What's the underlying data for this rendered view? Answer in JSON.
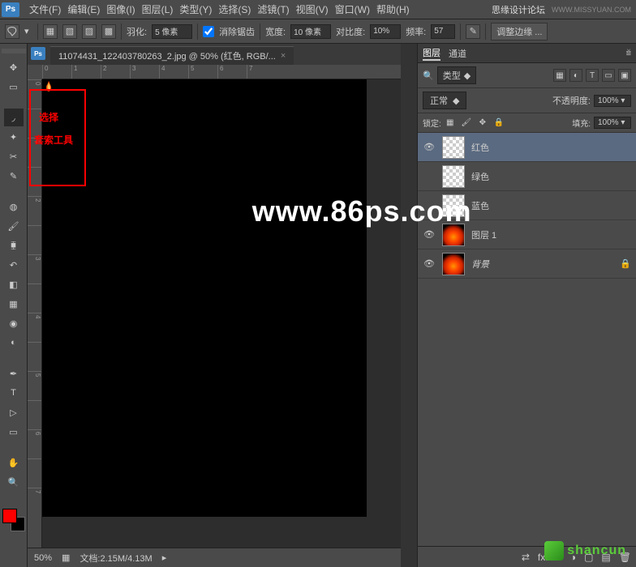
{
  "menubar": {
    "logo": "Ps",
    "items": [
      "文件(F)",
      "编辑(E)",
      "图像(I)",
      "图层(L)",
      "类型(Y)",
      "选择(S)",
      "滤镜(T)",
      "视图(V)",
      "窗口(W)",
      "帮助(H)"
    ],
    "forum": "思缘设计论坛",
    "url": "WWW.MISSYUAN.COM"
  },
  "options": {
    "feather_label": "羽化:",
    "feather_value": "5 像素",
    "antialias": "消除锯齿",
    "width_label": "宽度:",
    "width_value": "10 像素",
    "contrast_label": "对比度:",
    "contrast_value": "10%",
    "freq_label": "频率:",
    "freq_value": "57",
    "refine": "调整边缘 ..."
  },
  "doc": {
    "tab": "11074431_122403780263_2.jpg @ 50% (红色, RGB/...",
    "zoom": "50%",
    "status": "文档:2.15M/4.13M",
    "ruler_h": [
      "0",
      "1",
      "2",
      "3",
      "4",
      "5",
      "6",
      "7"
    ],
    "ruler_v": [
      "0",
      "",
      "1",
      "",
      "2",
      "",
      "3",
      "",
      "4",
      "",
      "5",
      "",
      "6",
      "",
      "7"
    ]
  },
  "watermark": "www.86ps.com",
  "annotation": {
    "line1": "选择",
    "line2": "套索工具"
  },
  "panel": {
    "tabs": {
      "layers": "图层",
      "channels": "通道"
    },
    "filter_mode": "类型",
    "blend_mode": "正常",
    "opacity_label": "不透明度:",
    "opacity": "100%",
    "lock_label": "锁定:",
    "fill_label": "填充:",
    "fill": "100%",
    "layers": [
      {
        "name": "红色",
        "sel": true,
        "checker": true,
        "vis": true
      },
      {
        "name": "绿色",
        "sel": false,
        "checker": true,
        "vis": false
      },
      {
        "name": "蓝色",
        "sel": false,
        "checker": true,
        "vis": false
      },
      {
        "name": "图层 1",
        "sel": false,
        "fire": true,
        "vis": true
      },
      {
        "name": "背景",
        "sel": false,
        "fire": true,
        "vis": true,
        "italic": true,
        "locked": true
      }
    ]
  },
  "bottom_wm": "shancun"
}
